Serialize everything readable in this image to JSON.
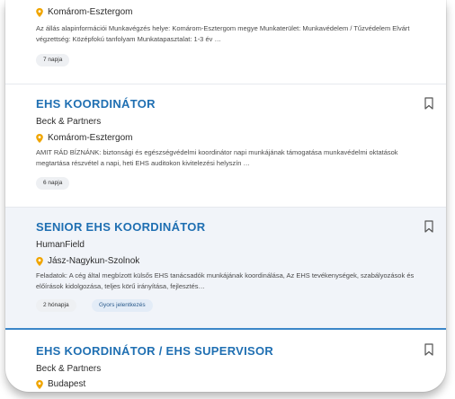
{
  "jobs": [
    {
      "title": "",
      "company": "",
      "location": "Komárom-Esztergom",
      "description": "Az állás alapinformációi Munkavégzés helye: Komárom-Esztergom megye Munkaterület: Munkavédelem / Tűzvédelem Elvárt végzettség: Középfokú tanfolyam Munkatapasztalat: 1-3 év …",
      "age": "7 napja"
    },
    {
      "title": "EHS KOORDINÁTOR",
      "company": "Beck & Partners",
      "location": "Komárom-Esztergom",
      "description": "AMIT RÁD BÍZNÁNK: biztonsági és egészségvédelmi koordinátor napi munkájának támogatása munkavédelmi oktatások megtartása részvétel a napi, heti EHS auditokon kivitelezési helyszín …",
      "age": "6 napja"
    },
    {
      "title": "SENIOR EHS KOORDINÁTOR",
      "company": "HumanField",
      "location": "Jász-Nagykun-Szolnok",
      "description": "Feladatok: A cég által megbízott külsős EHS tanácsadók munkájának koordinálása, Az EHS tevékenységek, szabályozások és előírások kidolgozása, teljes körű irányítása, fejlesztés…",
      "age": "2 hónapja",
      "badge": "Gyors jelentkezés"
    },
    {
      "title": "EHS KOORDINÁTOR / EHS SUPERVISOR",
      "company": "Beck & Partners",
      "location": "Budapest"
    }
  ],
  "colors": {
    "title": "#1f6fb2",
    "pin": "#f0a500",
    "highlight_bg": "#f1f4f9",
    "active_divider": "#3b86c8"
  },
  "icons": {
    "bookmark": "bookmark-icon",
    "location": "location-pin-icon"
  }
}
